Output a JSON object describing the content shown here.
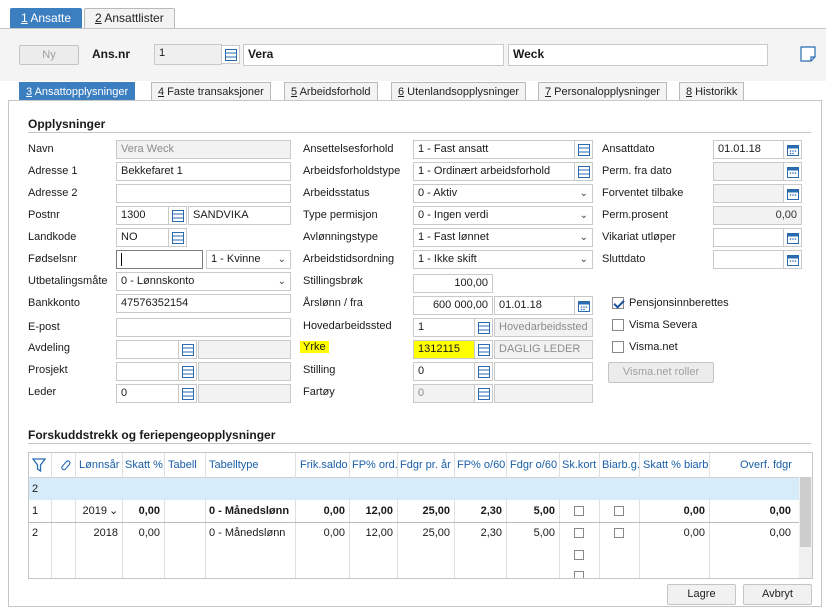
{
  "top_tabs": [
    {
      "key": "1",
      "label": " Ansatte"
    },
    {
      "key": "2",
      "label": " Ansattlister"
    }
  ],
  "header": {
    "new_label": "Ny",
    "ansnr_label": "Ans.nr",
    "ansnr_value": "1",
    "first_name": "Vera",
    "last_name": "Weck"
  },
  "sub_tabs": [
    {
      "key": "3",
      "label": " Ansattopplysninger"
    },
    {
      "key": "4",
      "label": " Faste transaksjoner"
    },
    {
      "key": "5",
      "label": " Arbeidsforhold"
    },
    {
      "key": "6",
      "label": " Utenlandsopplysninger"
    },
    {
      "key": "7",
      "label": " Personalopplysninger"
    },
    {
      "key": "8",
      "label": " Historikk"
    }
  ],
  "opplysninger": {
    "title": "Opplysninger",
    "navn_label": "Navn",
    "navn_value": "Vera  Weck",
    "adresse1_label": "Adresse 1",
    "adresse1_value": "Bekkefaret 1",
    "adresse2_label": "Adresse 2",
    "adresse2_value": "",
    "postnr_label": "Postnr",
    "postnr_value": "1300",
    "poststed_value": "SANDVIKA",
    "landkode_label": "Landkode",
    "landkode_value": "NO",
    "fodselsnr_label": "Fødselsnr",
    "fodselsnr_value": "",
    "kjonn_value": "1 - Kvinne",
    "utbetaling_label": "Utbetalingsmåte",
    "utbetaling_value": "0 - Lønnskonto",
    "bankkonto_label": "Bankkonto",
    "bankkonto_value": "47576352154",
    "epost_label": "E-post",
    "epost_value": "",
    "avdeling_label": "Avdeling",
    "prosjekt_label": "Prosjekt",
    "leder_label": "Leder",
    "leder_value": "0",
    "ansettelsesforhold_label": "Ansettelsesforhold",
    "ansettelsesforhold_value": "1 - Fast ansatt",
    "arbeidsforholdstype_label": "Arbeidsforholdstype",
    "arbeidsforholdstype_value": "1 - Ordinært arbeidsforhold",
    "arbeidsstatus_label": "Arbeidsstatus",
    "arbeidsstatus_value": "0 - Aktiv",
    "typepermisjon_label": "Type permisjon",
    "typepermisjon_value": "0 - Ingen verdi",
    "avlonningstype_label": "Avlønningstype",
    "avlonningstype_value": "1 - Fast lønnet",
    "arbeidstidsordning_label": "Arbeidstidsordning",
    "arbeidstidsordning_value": "1 - Ikke skift",
    "stillingsbrok_label": "Stillingsbrøk",
    "stillingsbrok_value": "100,00",
    "arslonn_label": "Årslønn / fra",
    "arslonn_value": "600 000,00",
    "arslonn_date": "01.01.18",
    "hovedarbeidssted_label": "Hovedarbeidssted",
    "hovedarbeidssted_value": "1",
    "hovedarbeidssted_name": "Hovedarbeidssted",
    "yrke_label": "Yrke",
    "yrke_value": "1312115",
    "yrke_name": "DAGLIG  LEDER",
    "stilling_label": "Stilling",
    "stilling_value": "0",
    "fartoy_label": "Fartøy",
    "fartoy_value": "0",
    "ansattdato_label": "Ansattdato",
    "ansattdato_value": "01.01.18",
    "permfra_label": "Perm. fra dato",
    "forventet_label": "Forventet tilbake",
    "permprosent_label": "Perm.prosent",
    "permprosent_value": "0,00",
    "vikariat_label": "Vikariat utløper",
    "sluttdato_label": "Sluttdato",
    "pensjon_label": "Pensjonsinnberettes",
    "severa_label": "Visma Severa",
    "vismanet_label": "Visma.net",
    "roller_label": "Visma.net roller"
  },
  "forskudd": {
    "title": "Forskuddstrekk og feriepengeopplysninger",
    "headers": [
      "Lønnsår",
      "Skatt %",
      "Tabell",
      "Tabelltype",
      "Frik.saldo",
      "FP% ord.",
      "Fdgr pr. år",
      "FP% o/60",
      "Fdgr o/60",
      "Sk.kort",
      "Biarb.g.",
      "Skatt % biarb",
      "Overf. fdgr"
    ],
    "filter_row": "2",
    "rows": [
      {
        "num": "1",
        "year": "2019",
        "skatt": "0,00",
        "tabell": "",
        "type": "0 - Månedslønn",
        "frik": "0,00",
        "fp": "12,00",
        "fdgr": "25,00",
        "fp60": "2,30",
        "fdgr60": "5,00",
        "biarb": "0,00",
        "overf": "0,00"
      },
      {
        "num": "2",
        "year": "2018",
        "skatt": "0,00",
        "tabell": "",
        "type": "0 - Månedslønn",
        "frik": "0,00",
        "fp": "12,00",
        "fdgr": "25,00",
        "fp60": "2,30",
        "fdgr60": "5,00",
        "biarb": "0,00",
        "overf": "0,00"
      }
    ]
  },
  "footer": {
    "save_label": "Lagre",
    "cancel_label": "Avbryt"
  },
  "colors": {
    "accent": "#3c7fc1",
    "highlight": "#ffff00",
    "header_text": "#1a5fa8"
  }
}
